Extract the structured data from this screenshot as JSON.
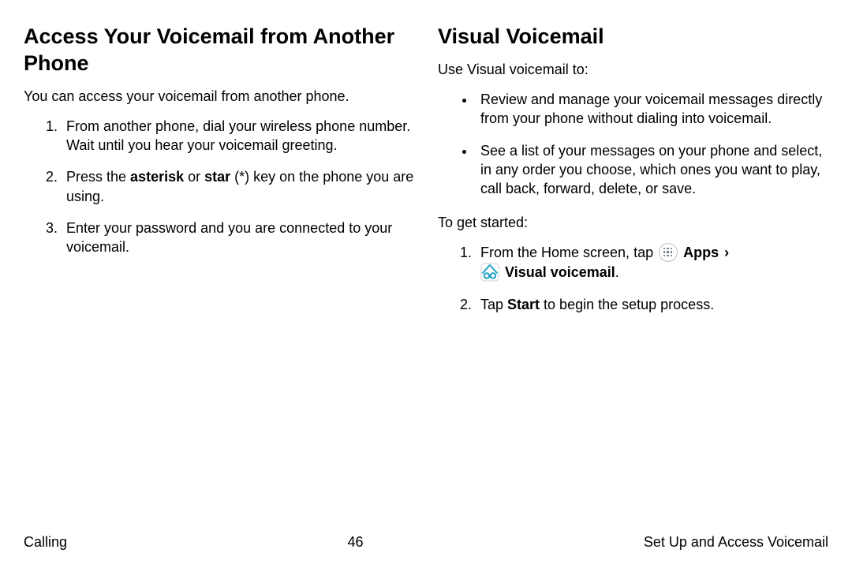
{
  "left": {
    "heading": "Access Your Voicemail from Another Phone",
    "intro": "You can access your voicemail from another phone.",
    "steps": {
      "s1": "From another phone, dial your wireless phone number. Wait until you hear your voicemail greeting.",
      "s2_pre": "Press the ",
      "s2_b1": "asterisk",
      "s2_mid": " or ",
      "s2_b2": "star",
      "s2_post": " (*) key on the phone you are using.",
      "s3": "Enter your password and you are connected to your voicemail."
    }
  },
  "right": {
    "heading": "Visual Voicemail",
    "intro": "Use Visual voicemail to:",
    "bullets": {
      "b1": "Review and manage your voicemail messages directly from your phone without dialing into voicemail.",
      "b2": "See a list of your messages on your phone and select, in any order you choose, which ones you want to play, call back, forward, delete, or save."
    },
    "toget": "To get started:",
    "steps": {
      "s1_pre": "From the Home screen, tap ",
      "s1_apps": "Apps",
      "s1_chev": "›",
      "s1_vv": "Visual voicemail",
      "s1_post": ".",
      "s2_pre": "Tap ",
      "s2_b": "Start",
      "s2_post": " to begin the setup process."
    }
  },
  "footer": {
    "left": "Calling",
    "center": "46",
    "right": "Set Up and Access Voicemail"
  }
}
